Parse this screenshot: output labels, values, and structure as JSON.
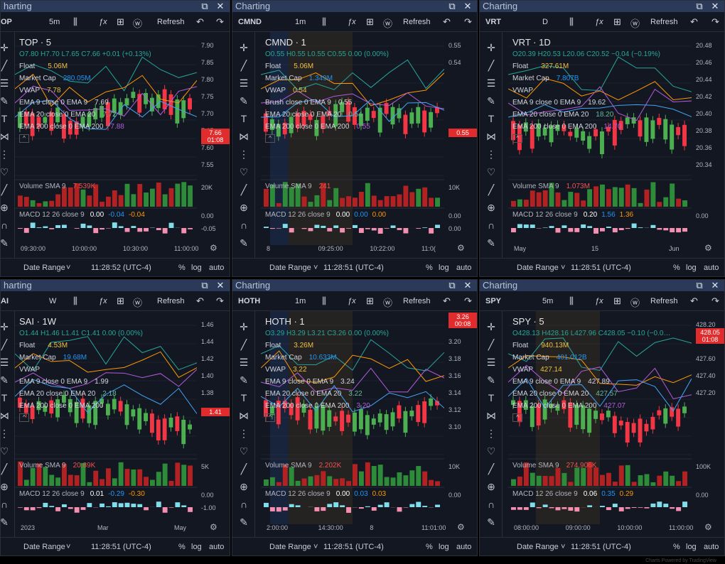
{
  "panels": [
    {
      "id": "top",
      "title": "harting",
      "symbol": "TOP · 5",
      "toolbar_sym": "OP",
      "interval": "5m",
      "ohlc": "O7.80 H7.70 L7.65 C7.66 +0.01 (+0.13%)",
      "float_label": "Float",
      "float": "5.06M",
      "mcap_label": "Market Cap",
      "mcap": "280.05M",
      "vwap_label": "VWAP",
      "vwap": "7.78",
      "ema9": "EMA 9 close 0 EMA 9",
      "ema9v": "7.69",
      "ema20": "EMA 20 close 0 EMA 20",
      "ema20v": "7.72",
      "ema200": "EMA 200 close 0 EMA 200",
      "ema200v": "7.88",
      "vol": "Volume SMA 9",
      "volv": "7.539K",
      "macd": "MACD 12 26 close 9",
      "macd1": "0.00",
      "macd2": "-0.04",
      "macd3": "-0.04",
      "yticks": [
        "7.90",
        "7.85",
        "7.80",
        "7.75",
        "7.70",
        "7.65",
        "7.60",
        "7.55"
      ],
      "price_badge": "7.66",
      "badge_time": "01:08",
      "vol_tick": "20K",
      "macd_ticks": [
        "0.00",
        "-0.05"
      ],
      "xticks": [
        "09:30:00",
        "10:00:00",
        "10:30:00",
        "11:00:00"
      ],
      "time": "11:28:52 (UTC-4)"
    },
    {
      "id": "cmnd",
      "title": "Charting",
      "symbol": "CMND · 1",
      "toolbar_sym": "CMND",
      "interval": "1m",
      "ohlc": "O0.55 H0.55 L0.55 C0.55 0.00 (0.00%)",
      "float": "5.06M",
      "mcap": "1.349M",
      "vwap": "0.54",
      "ema9": "Brush close 0 EMA 9",
      "ema9v": "0.55",
      "ema20": "EMA 20 close 0 EMA 20",
      "ema20v": "0.54",
      "ema200": "EMA 200 close 0 EMA 200",
      "ema200v": "0.55",
      "vol": "Volume SMA 9",
      "volv": "241",
      "macd": "MACD 12 26 close 9",
      "macd1": "0.00",
      "macd2": "0.00",
      "macd3": "0.00",
      "yticks": [
        "0.55",
        "0.54"
      ],
      "price_badge": "0.55",
      "vol_tick": "10K",
      "macd_ticks": [
        "0.00",
        "0.00"
      ],
      "xticks": [
        "8",
        "09:25:00",
        "10:22:00",
        "11:0("
      ],
      "time": "11:28:51 (UTC-4)"
    },
    {
      "id": "vrt",
      "title": "Charting",
      "symbol": "VRT · 1D",
      "toolbar_sym": "VRT",
      "interval": "D",
      "ohlc": "O20.39 H20.53 L20.06 C20.52 −0.04 (−0.19%)",
      "float": "327.61M",
      "mcap": "7.807B",
      "vwap": "",
      "ema9": "EMA 9 close 0 EMA 9",
      "ema9v": "19.62",
      "ema20": "EMA 20 close 0 EMA 20",
      "ema20v": "18.20",
      "ema200": "EMA 200 close 0 EMA 200",
      "ema200v": "14.70",
      "vol": "Volume SMA 9",
      "volv": "1.073M",
      "macd": "MACD 12 26 close 9",
      "macd1": "0.20",
      "macd2": "1.56",
      "macd3": "1.36",
      "yticks": [
        "20.48",
        "20.46",
        "20.44",
        "20.42",
        "20.40",
        "20.38",
        "20.36",
        "20.34"
      ],
      "macd_ticks": [
        "0.00"
      ],
      "xticks": [
        "May",
        "15",
        "Jun"
      ],
      "time": "11:28:51 (UTC-4)"
    },
    {
      "id": "sai",
      "title": "harting",
      "symbol": "SAI · 1W",
      "toolbar_sym": "AI",
      "interval": "W",
      "ohlc": "O1.44 H1.46 L1.41 C1.41 0.00 (0.00%)",
      "float": "4.53M",
      "mcap": "19.68M",
      "vwap": "",
      "ema9": "EMA 9 close 0 EMA 9",
      "ema9v": "1.99",
      "ema20": "EMA 20 close 0 EMA 20",
      "ema20v": "2.18",
      "ema200": "EMA 200 close 0 EMA 200",
      "ema200v": "",
      "vol": "Volume SMA 9",
      "volv": "20.89K",
      "macd": "MACD 12 26 close 9",
      "macd1": "0.01",
      "macd2": "-0.29",
      "macd3": "-0.30",
      "yticks": [
        "1.46",
        "1.44",
        "1.42",
        "1.40",
        "1.38"
      ],
      "price_badge": "1.41",
      "vol_tick": "5K",
      "macd_ticks": [
        "0.00",
        "-1.00"
      ],
      "xticks": [
        "2023",
        "Mar",
        "May"
      ],
      "time": "11:28:51 (UTC-4)"
    },
    {
      "id": "hoth",
      "title": "Charting",
      "symbol": "HOTH · 1",
      "toolbar_sym": "HOTH",
      "interval": "1m",
      "ohlc": "O3.29 H3.29 L3.21 C3.26 0.00 (0.00%)",
      "float": "3.26M",
      "mcap": "10.633M",
      "vwap": "3.22",
      "ema9": "EMA 9 close 0 EMA 9",
      "ema9v": "3.24",
      "ema20": "EMA 20 close 0 EMA 20",
      "ema20v": "3.22",
      "ema200": "EMA 200 close 0 EMA 200",
      "ema200v": "3.20",
      "vol": "Volume SMA 9",
      "volv": "2.202K",
      "macd": "MACD 12 26 close 9",
      "macd1": "0.00",
      "macd2": "0.03",
      "macd3": "0.03",
      "yticks": [
        "3.22",
        "3.20",
        "3.18",
        "3.16",
        "3.14",
        "3.12",
        "3.10"
      ],
      "price_badge": "3.26",
      "badge_time": "00:08",
      "vol_tick": "10K",
      "macd_ticks": [
        "0.00"
      ],
      "xticks": [
        "2:00:00",
        "14:30:00",
        "8",
        "11:01:00"
      ],
      "time": "11:28:51 (UTC-4)"
    },
    {
      "id": "spy",
      "title": "Charting",
      "symbol": "SPY · 5",
      "toolbar_sym": "SPY",
      "interval": "5m",
      "ohlc": "O428.13 H428.16 L427.96 C428.05 −0.10 (−0.0…",
      "float": "940.13M",
      "mcap": "401.012B",
      "vwap": "427.14",
      "ema9": "EMA 9 close 0 EMA 9",
      "ema9v": "427.89",
      "ema20": "EMA 20 close 0 EMA 20",
      "ema20v": "427.57",
      "ema200": "EMA 200 close 0 EMA 200",
      "ema200v": "427.07",
      "vol": "Volume SMA 9",
      "volv": "274.906K",
      "macd": "MACD 12 26 close 9",
      "macd1": "0.06",
      "macd2": "0.35",
      "macd3": "0.29",
      "yticks": [
        "428.20",
        "427.80",
        "427.60",
        "427.40",
        "427.20"
      ],
      "price_badge": "428.05",
      "badge_time": "01:08",
      "vol_tick": "100K",
      "macd_ticks": [
        "0.00"
      ],
      "xticks": [
        "08:00:00",
        "09:00:00",
        "10:00:00",
        "11:00:00"
      ],
      "time": "11:28:51 (UTC-4)"
    }
  ],
  "labels": {
    "float": "Float",
    "mcap": "Market Cap",
    "vwap": "VWAP",
    "refresh": "Refresh",
    "date_range": "Date Range",
    "pct": "%",
    "log": "log",
    "auto": "auto"
  },
  "colors": {
    "up": "#4caf50",
    "down": "#f23645",
    "bg": "#131722",
    "title": "#2a3a58"
  },
  "footer": "Charts Powered by TradingView"
}
